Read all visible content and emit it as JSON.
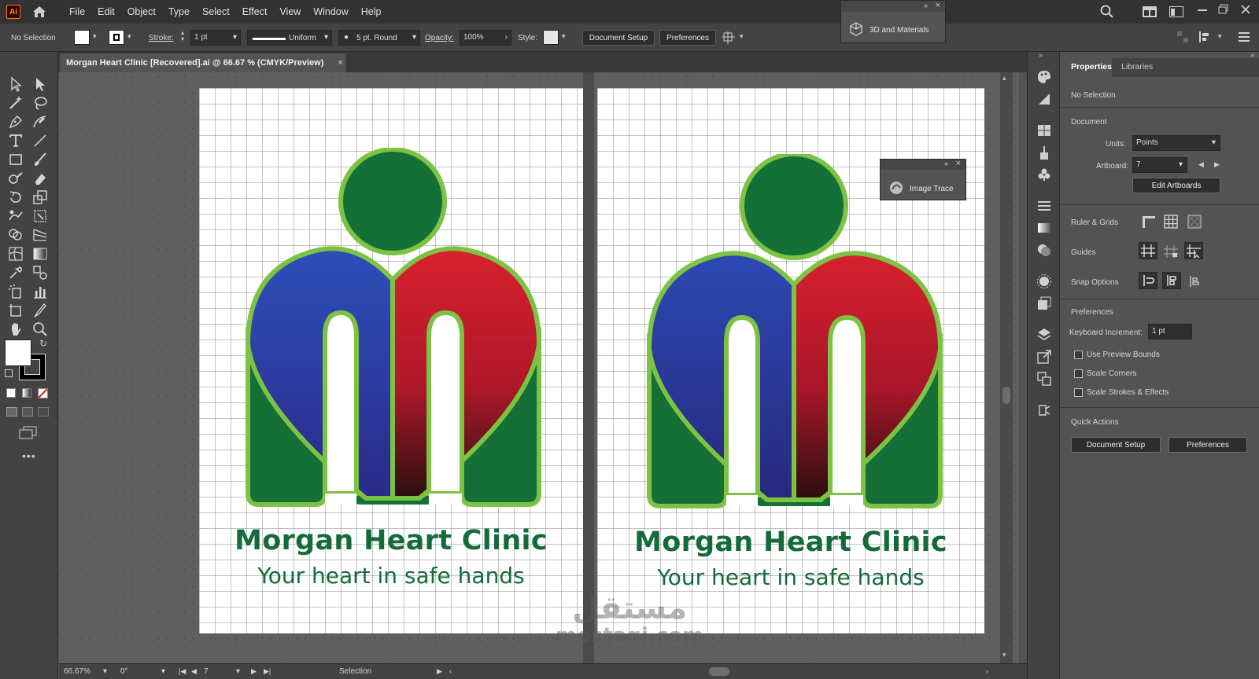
{
  "app": {
    "logo_text": "Ai"
  },
  "menu": [
    "File",
    "Edit",
    "Object",
    "Type",
    "Select",
    "Effect",
    "View",
    "Window",
    "Help"
  ],
  "control_bar": {
    "selection_status": "No Selection",
    "stroke_label": "Stroke:",
    "stroke_weight": "1 pt",
    "stroke_profile": "Uniform",
    "brush": "5 pt. Round",
    "opacity_label": "Opacity:",
    "opacity_value": "100%",
    "style_label": "Style:",
    "document_setup_button": "Document Setup",
    "preferences_button": "Preferences"
  },
  "panels": {
    "materials_3d": "3D and Materials",
    "image_trace": "Image Trace"
  },
  "document_tab": {
    "title": "Morgan Heart Clinic [Recovered].ai @ 66.67 % (CMYK/Preview)",
    "close": "×"
  },
  "artwork": {
    "title": "Morgan Heart Clinic",
    "tagline": "Your heart in safe hands",
    "colors": {
      "green_dark": "#146b3a",
      "green_light": "#7dc242",
      "blue": "#2b3a9e",
      "red": "#d0212f"
    }
  },
  "watermark": {
    "arabic": "مستقل",
    "latin": "mostaqi.com"
  },
  "status_bar": {
    "zoom": "66.67%",
    "rotation": "0°",
    "artboard_number": "7",
    "tool": "Selection"
  },
  "properties": {
    "tab_properties": "Properties",
    "tab_libraries": "Libraries",
    "selection": "No Selection",
    "document_header": "Document",
    "units_label": "Units:",
    "units_value": "Points",
    "artboard_label": "Artboard:",
    "artboard_value": "7",
    "edit_artboards_button": "Edit Artboards",
    "ruler_grids_label": "Ruler & Grids",
    "guides_label": "Guides",
    "snap_options_label": "Snap Options",
    "preferences_header": "Preferences",
    "keyboard_increment_label": "Keyboard Increment:",
    "keyboard_increment_value": "1 pt",
    "checks": [
      "Use Preview Bounds",
      "Scale Corners",
      "Scale Strokes & Effects"
    ],
    "quick_actions_header": "Quick Actions",
    "document_setup_button": "Document Setup",
    "preferences_button": "Preferences"
  }
}
